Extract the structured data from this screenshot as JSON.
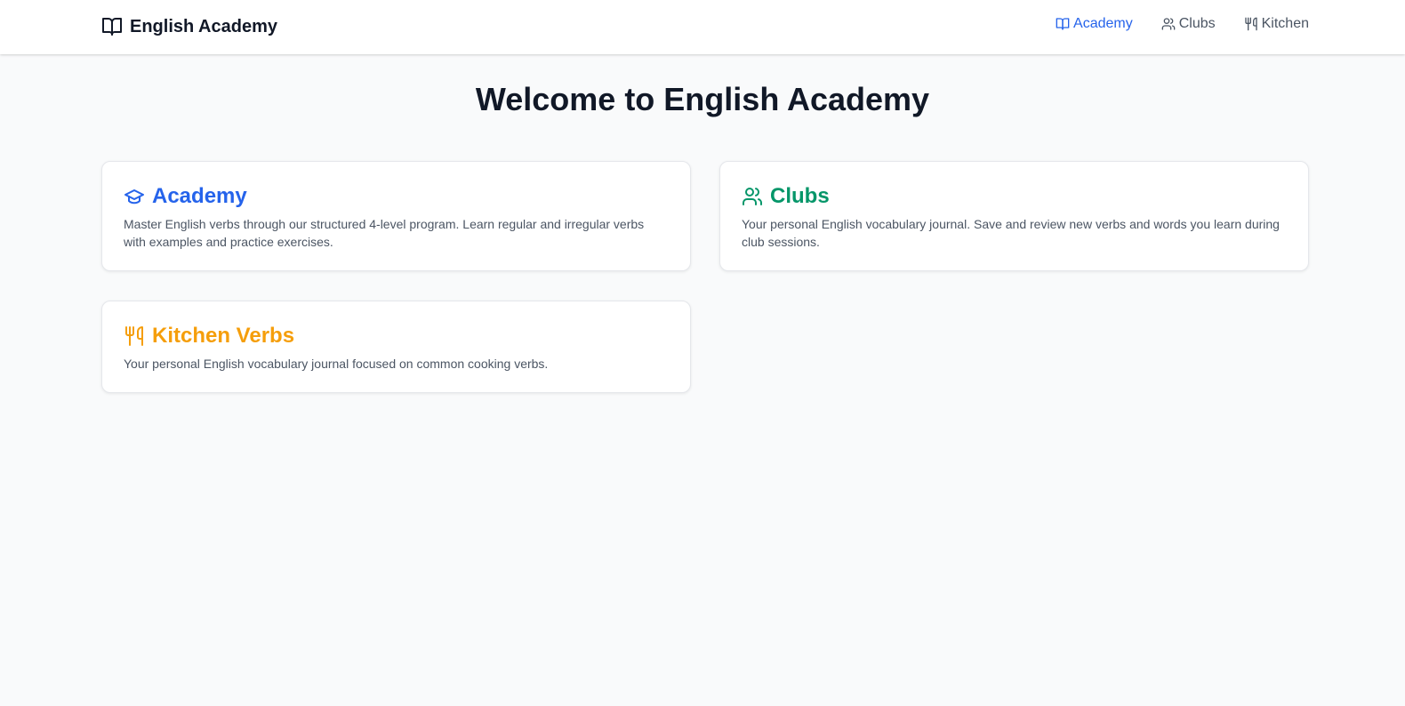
{
  "nav": {
    "brand": "English Academy",
    "brand_icon": "book-open-icon",
    "links": [
      {
        "label": "Academy",
        "icon": "book-open-icon",
        "active": true
      },
      {
        "label": "Clubs",
        "icon": "users-icon",
        "active": false
      },
      {
        "label": "Kitchen",
        "icon": "utensils-icon",
        "active": false
      }
    ]
  },
  "main": {
    "title": "Welcome to English Academy",
    "cards": [
      {
        "title": "Academy",
        "icon": "graduation-cap-icon",
        "color": "#2563eb",
        "description": "Master English verbs through our structured 4-level program. Learn regular and irregular verbs with examples and practice exercises."
      },
      {
        "title": "Clubs",
        "icon": "users-icon",
        "color": "#059669",
        "description": "Your personal English vocabulary journal. Save and review new verbs and words you learn during club sessions."
      },
      {
        "title": "Kitchen Verbs",
        "icon": "utensils-icon",
        "color": "#f59e0b",
        "description": "Your personal English vocabulary journal focused on common cooking verbs."
      }
    ]
  },
  "colors": {
    "active_link": "#2563eb",
    "link": "#4b5563",
    "page_bg": "#f9fafb",
    "card_bg": "#ffffff"
  }
}
